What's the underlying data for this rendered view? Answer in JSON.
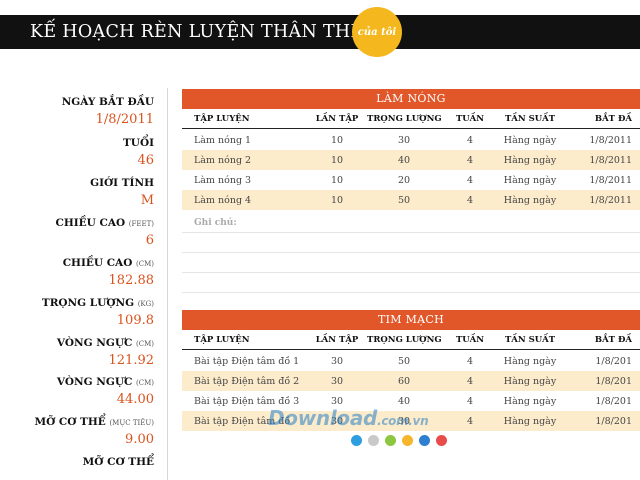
{
  "header": {
    "title": "KẾ HOẠCH RÈN LUYỆN THÂN THỂ",
    "badge": "của tôi"
  },
  "sidebar": [
    {
      "label": "NGÀY BẮT ĐẦU",
      "unit": "",
      "value": "1/8/2011"
    },
    {
      "label": "TUỔI",
      "unit": "",
      "value": "46"
    },
    {
      "label": "GIỚI TÍNH",
      "unit": "",
      "value": "M"
    },
    {
      "label": "CHIỀU CAO",
      "unit": "(FEET)",
      "value": "6"
    },
    {
      "label": "CHIỀU CAO",
      "unit": "(CM)",
      "value": "182.88"
    },
    {
      "label": "TRỌNG LƯỢNG",
      "unit": "(KG)",
      "value": "109.8"
    },
    {
      "label": "VÒNG NGỰC",
      "unit": "(CM)",
      "value": "121.92"
    },
    {
      "label": "VÒNG NGỰC",
      "unit": "(CM)",
      "value": "44.00"
    },
    {
      "label": "MỠ CƠ THỂ",
      "unit": "(MỤC TIÊU)",
      "value": "9.00"
    },
    {
      "label": "MỠ CƠ THỂ",
      "unit": "",
      "value": ""
    }
  ],
  "warmup": {
    "title": "LÀM NÓNG",
    "columns": [
      "TẬP LUYỆN",
      "LẦN TẬP",
      "TRỌNG LƯỢNG",
      "TUẦN",
      "TẦN SUẤT",
      "BẮT ĐẦ"
    ],
    "rows": [
      [
        "Làm nóng 1",
        "10",
        "30",
        "4",
        "Hàng ngày",
        "1/8/2011"
      ],
      [
        "Làm nóng 2",
        "10",
        "40",
        "4",
        "Hàng ngày",
        "1/8/2011"
      ],
      [
        "Làm nóng  3",
        "10",
        "20",
        "4",
        "Hàng ngày",
        "1/8/2011"
      ],
      [
        "Làm nóng  4",
        "10",
        "50",
        "4",
        "Hàng ngày",
        "1/8/2011"
      ]
    ],
    "notes_label": "Ghi chú:"
  },
  "cardio": {
    "title": "TIM MẠCH",
    "columns": [
      "TẬP LUYỆN",
      "LẦN TẬP",
      "TRỌNG LƯỢNG",
      "TUẦN",
      "TẦN SUẤT",
      "BẮT ĐẦ"
    ],
    "rows": [
      [
        "Bài tập Điện tâm đồ 1",
        "30",
        "50",
        "4",
        "Hàng ngày",
        "1/8/201"
      ],
      [
        "Bài tập Điện tâm đồ 2",
        "30",
        "60",
        "4",
        "Hàng ngày",
        "1/8/201"
      ],
      [
        "Bài tập Điện tâm đồ 3",
        "30",
        "40",
        "4",
        "Hàng ngày",
        "1/8/201"
      ],
      [
        "Bài tập Điện tâm đồ",
        "30",
        "30",
        "4",
        "Hàng ngày",
        "1/8/201"
      ]
    ]
  },
  "watermark": {
    "main": "Download",
    "tld": ".com.vn"
  },
  "colors": {
    "accent": "#e2572a",
    "value_text": "#d9531e",
    "badge": "#f4b81e",
    "row_alt": "#fdeccc",
    "dots": [
      "#2d9ee0",
      "#c9c9c9",
      "#8dc63f",
      "#f7b52c",
      "#2f7fd1",
      "#e94b4b"
    ]
  }
}
